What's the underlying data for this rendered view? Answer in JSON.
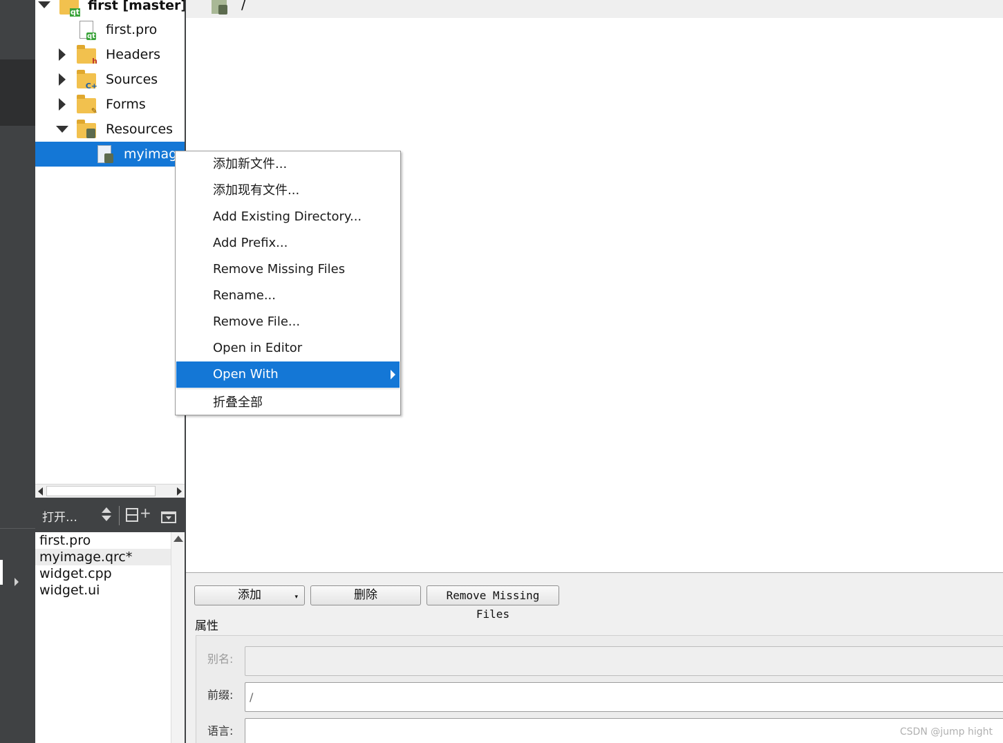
{
  "project_tree": {
    "root": {
      "label": "first [master]",
      "icon": "qt-project-folder-icon"
    },
    "items": [
      {
        "label": "first.pro",
        "icon": "qt-pro-file-icon"
      },
      {
        "label": "Headers",
        "icon": "headers-folder-icon"
      },
      {
        "label": "Sources",
        "icon": "sources-folder-icon"
      },
      {
        "label": "Forms",
        "icon": "forms-folder-icon"
      },
      {
        "label": "Resources",
        "icon": "resources-folder-icon"
      },
      {
        "label": "myimage.qrc",
        "icon": "qrc-file-icon"
      }
    ]
  },
  "open_docs": {
    "title": "打开…",
    "files": [
      "first.pro",
      "myimage.qrc*",
      "widget.cpp",
      "widget.ui"
    ]
  },
  "editor": {
    "prefix_path": "/"
  },
  "resource_editor": {
    "buttons": {
      "add": "添加",
      "remove": "删除",
      "remove_missing": "Remove Missing Files"
    },
    "properties_label": "属性",
    "fields": {
      "alias_label": "别名:",
      "alias_value": "",
      "prefix_label": "前缀:",
      "prefix_value": "/",
      "language_label": "语言:",
      "language_value": ""
    }
  },
  "context_menu": {
    "items": [
      "添加新文件...",
      "添加现有文件...",
      "Add Existing Directory...",
      "Add Prefix...",
      "Remove Missing Files",
      "Rename...",
      "Remove File...",
      "Open in Editor",
      "Open With",
      "折叠全部"
    ],
    "highlighted": "Open With"
  },
  "watermark": "CSDN @jump hight",
  "colors": {
    "selection": "#1477d6",
    "sidebar_dark": "#404244",
    "folder_yellow": "#f2c14e",
    "qt_green": "#3aa33a"
  }
}
